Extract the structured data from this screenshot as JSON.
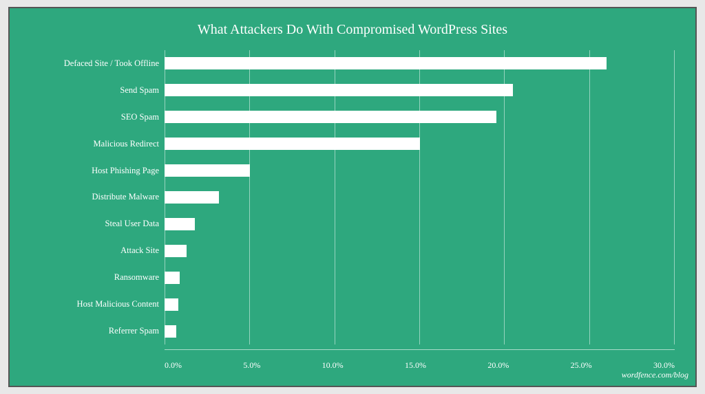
{
  "chart": {
    "title": "What Attackers Do With Compromised WordPress Sites",
    "watermark": "wordfence.com/blog",
    "background_color": "#2ea87e",
    "max_value": 30,
    "x_axis_labels": [
      "0.0%",
      "5.0%",
      "10.0%",
      "15.0%",
      "20.0%",
      "25.0%",
      "30.0%"
    ],
    "bars": [
      {
        "label": "Defaced Site / Took Offline",
        "value": 26.0,
        "pct": 86.67
      },
      {
        "label": "Send Spam",
        "value": 20.5,
        "pct": 68.33
      },
      {
        "label": "SEO Spam",
        "value": 19.5,
        "pct": 65.0
      },
      {
        "label": "Malicious Redirect",
        "value": 15.0,
        "pct": 50.0
      },
      {
        "label": "Host Phishing Page",
        "value": 5.0,
        "pct": 16.67
      },
      {
        "label": "Distribute Malware",
        "value": 3.2,
        "pct": 10.67
      },
      {
        "label": "Steal User Data",
        "value": 1.8,
        "pct": 6.0
      },
      {
        "label": "Attack Site",
        "value": 1.3,
        "pct": 4.33
      },
      {
        "label": "Ransomware",
        "value": 0.9,
        "pct": 3.0
      },
      {
        "label": "Host Malicious Content",
        "value": 0.8,
        "pct": 2.67
      },
      {
        "label": "Referrer Spam",
        "value": 0.7,
        "pct": 2.33
      }
    ]
  }
}
